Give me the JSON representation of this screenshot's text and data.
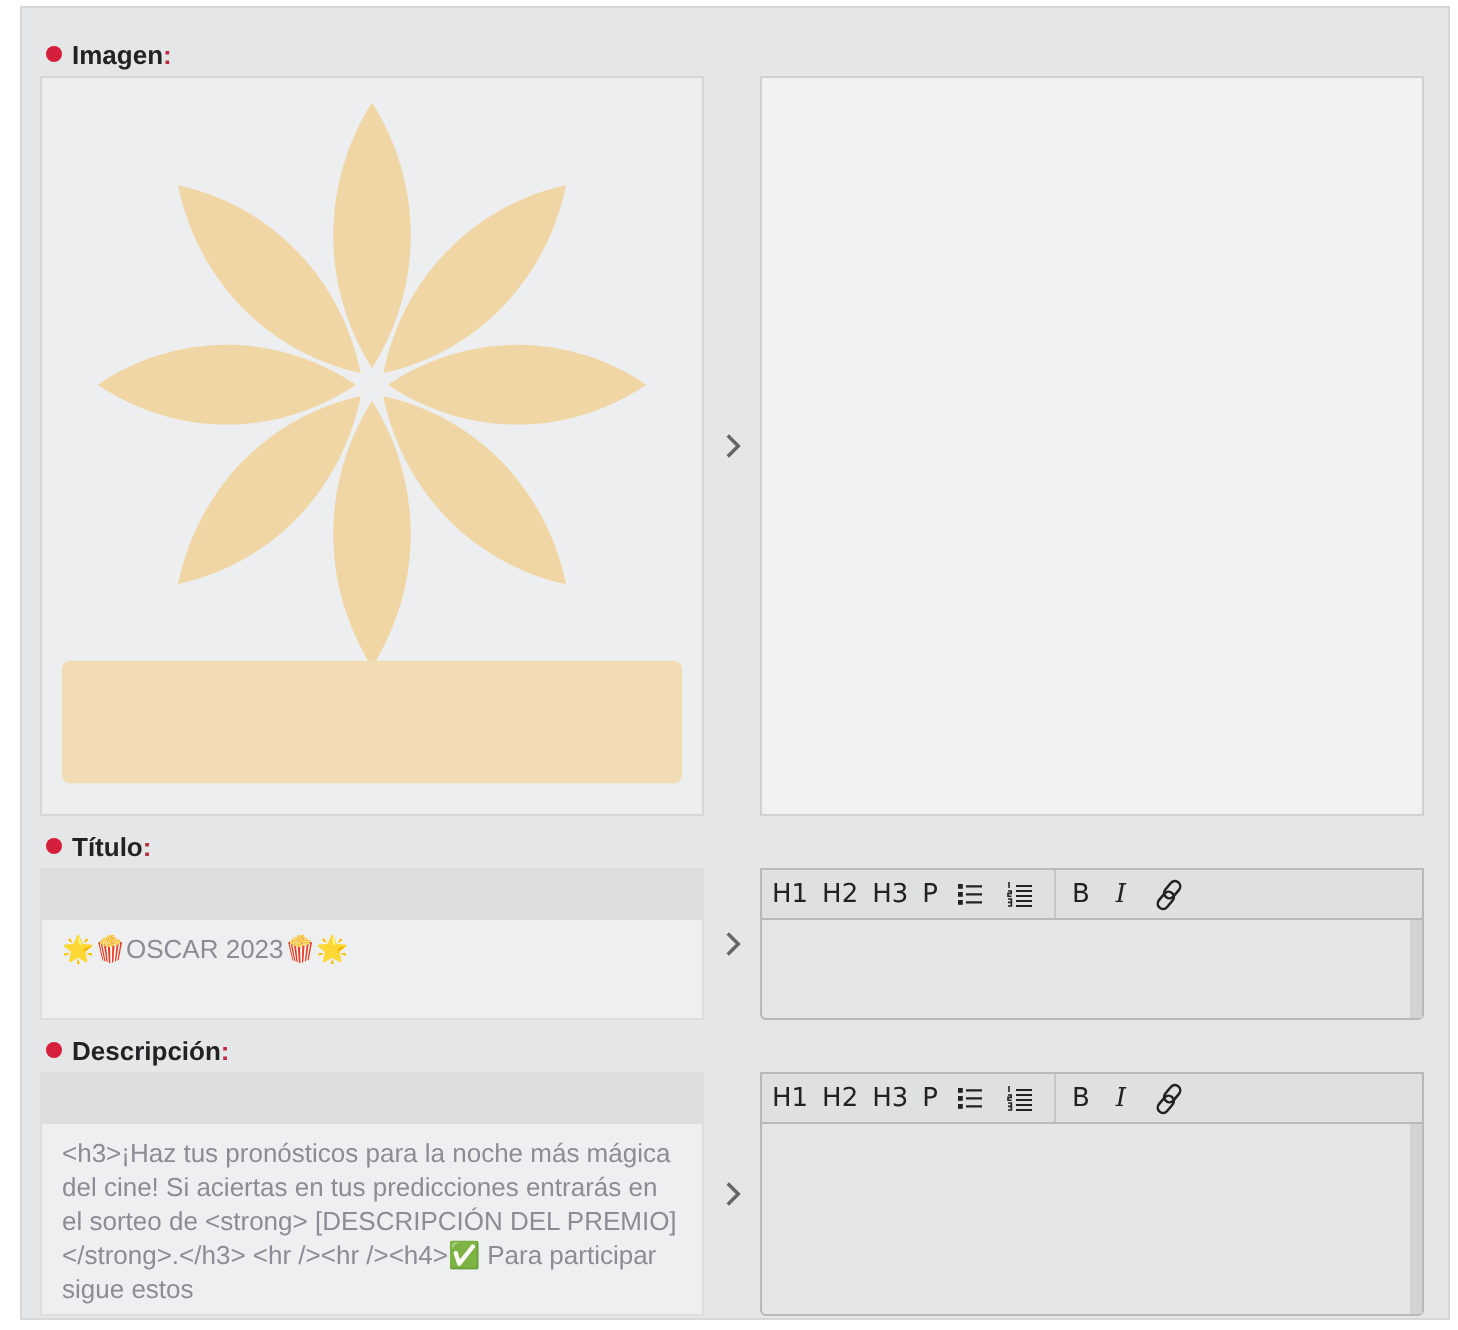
{
  "fields": [
    {
      "label": "Imagen",
      "required": true,
      "required_mark": ":"
    },
    {
      "kind": "text",
      "label": "Título",
      "required": true,
      "required_mark": ":",
      "source_text": "🌟🍿OSCAR 2023🍿🌟",
      "toolbar": [
        [
          {
            "kind": "text",
            "label": "H1"
          },
          {
            "kind": "text",
            "label": "H2"
          },
          {
            "kind": "text",
            "label": "H3"
          },
          {
            "kind": "text",
            "label": "P"
          },
          {
            "kind": "bullets"
          },
          {
            "kind": "numbers"
          }
        ],
        [
          {
            "kind": "text",
            "label": "B"
          },
          {
            "kind": "text",
            "label": "I",
            "italic": true
          },
          {
            "kind": "link"
          }
        ]
      ]
    },
    {
      "kind": "text",
      "label": "Descripción",
      "required": true,
      "required_mark": ":",
      "source_text": "<h3>¡Haz tus pronósticos para la noche más mágica del cine! Si aciertas en tus predicciones entrarás en el sorteo de <strong> [DESCRIPCIÓN DEL PREMIO]</strong>.</h3> <hr /><hr /><h4>✅ Para participar sigue estos",
      "toolbar": [
        [
          {
            "kind": "text",
            "label": "H1"
          },
          {
            "kind": "text",
            "label": "H2"
          },
          {
            "kind": "text",
            "label": "H3"
          },
          {
            "kind": "text",
            "label": "P"
          },
          {
            "kind": "bullets"
          },
          {
            "kind": "numbers"
          }
        ],
        [
          {
            "kind": "text",
            "label": "B"
          },
          {
            "kind": "text",
            "label": "I",
            "italic": true
          },
          {
            "kind": "link"
          }
        ]
      ]
    }
  ]
}
